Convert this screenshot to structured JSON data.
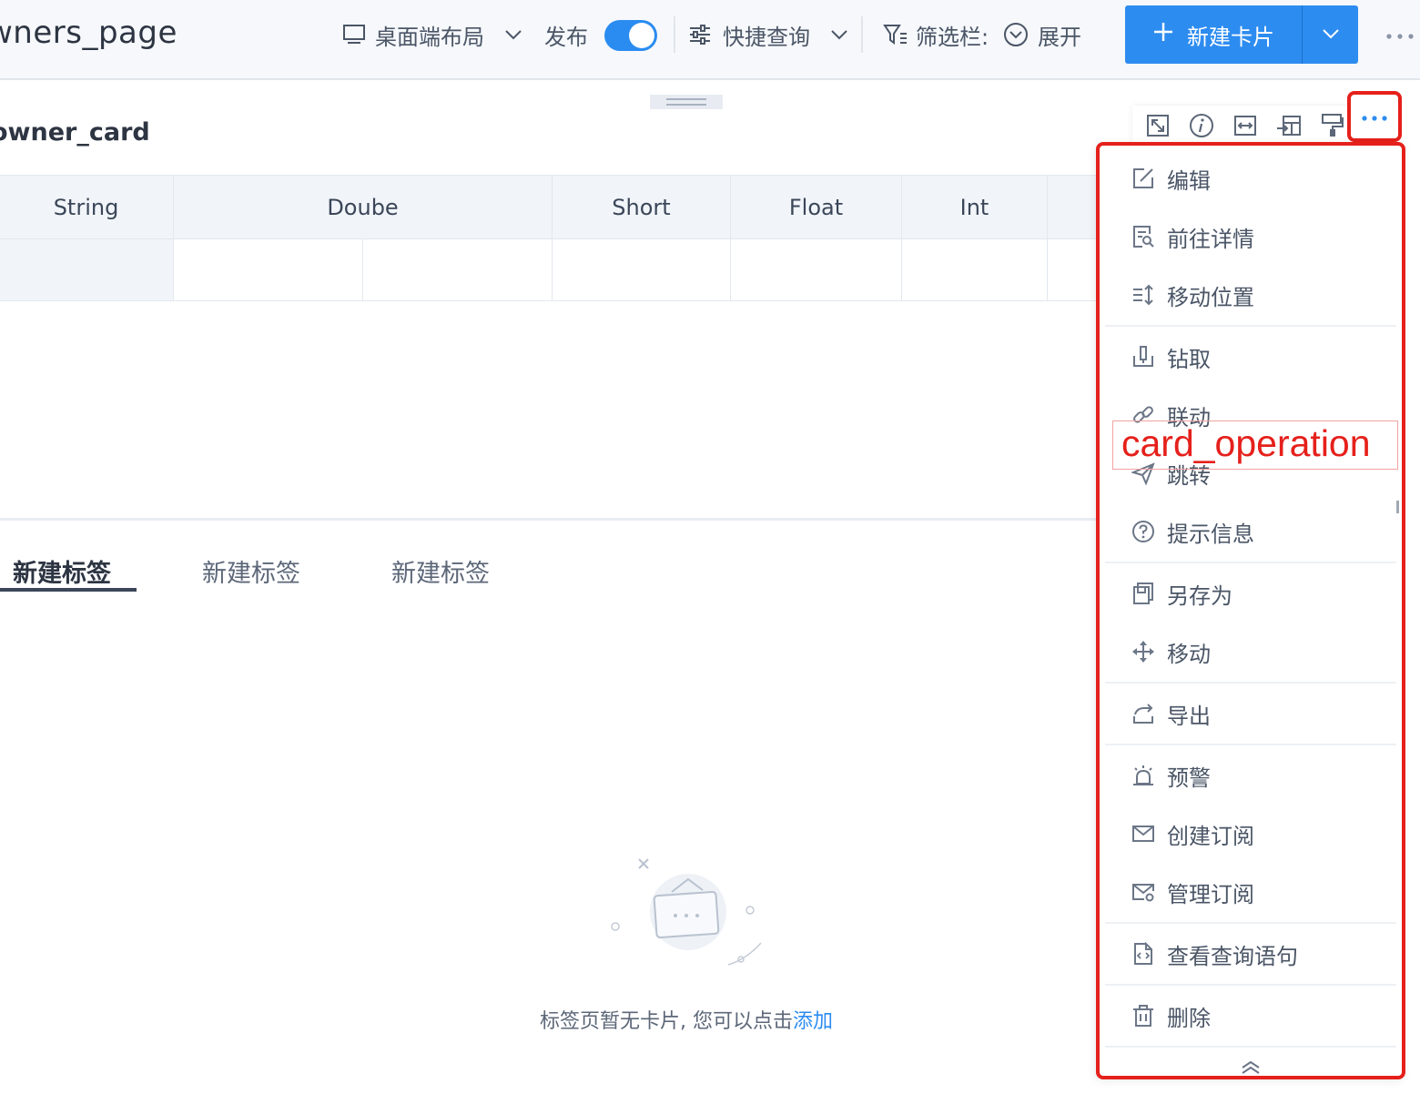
{
  "topbar": {
    "page_title": "wners_page",
    "layout_label": "桌面端布局",
    "publish_label": "发布",
    "publish_on": true,
    "quick_query_label": "快捷查询",
    "filter_label": "筛选栏:",
    "expand_label": "展开",
    "new_card_label": "新建卡片"
  },
  "card": {
    "title": "owner_card",
    "columns": [
      "String",
      "Doube",
      "Short",
      "Float",
      "Int"
    ],
    "tools": [
      "fullscreen-icon",
      "info-icon",
      "fit-width-icon",
      "layout-icon",
      "format-painter-icon",
      "more-icon"
    ]
  },
  "tabs": [
    {
      "label": "新建标签",
      "active": true
    },
    {
      "label": "新建标签",
      "active": false
    },
    {
      "label": "新建标签",
      "active": false
    }
  ],
  "empty": {
    "text": "标签页暂无卡片, 您可以点击",
    "link": "添加"
  },
  "menu": {
    "items": [
      {
        "label": "编辑",
        "icon": "edit-icon"
      },
      {
        "label": "前往详情",
        "icon": "detail-icon"
      },
      {
        "label": "移动位置",
        "icon": "reorder-icon"
      },
      {
        "label": "钻取",
        "icon": "drill-icon"
      },
      {
        "label": "联动",
        "icon": "link-icon"
      },
      {
        "label": "跳转",
        "icon": "send-icon"
      },
      {
        "label": "提示信息",
        "icon": "help-icon"
      },
      {
        "label": "另存为",
        "icon": "save-as-icon"
      },
      {
        "label": "移动",
        "icon": "move-icon"
      },
      {
        "label": "导出",
        "icon": "export-icon"
      },
      {
        "label": "预警",
        "icon": "alarm-icon"
      },
      {
        "label": "创建订阅",
        "icon": "mail-icon"
      },
      {
        "label": "管理订阅",
        "icon": "mail-settings-icon"
      },
      {
        "label": "查看查询语句",
        "icon": "code-file-icon"
      },
      {
        "label": "删除",
        "icon": "trash-icon"
      }
    ]
  },
  "annotation": {
    "label": "card_operation",
    "color": "#e5201b"
  },
  "colors": {
    "accent": "#2d8cf0",
    "highlight": "#e5201b"
  }
}
